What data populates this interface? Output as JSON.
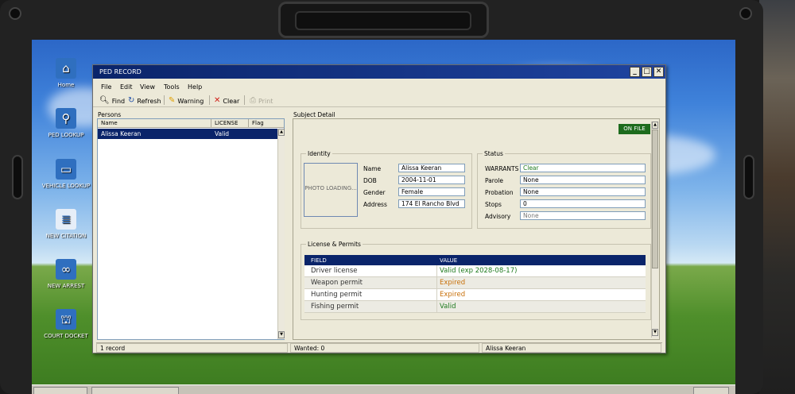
{
  "window": {
    "title": "PED RECORD",
    "min": "_",
    "max": "□",
    "close": "✕"
  },
  "desktop": {
    "icons": [
      {
        "label": "Home",
        "icon": "home-icon"
      },
      {
        "label": "PED LOOKUP",
        "icon": "person-search-icon"
      },
      {
        "label": "VEHICLE LOOKUP",
        "icon": "vehicle-search-icon"
      },
      {
        "label": "NEW CITATION",
        "icon": "citation-icon"
      },
      {
        "label": "NEW ARREST",
        "icon": "handcuffs-icon"
      },
      {
        "label": "COURT DOCKET",
        "icon": "courthouse-icon"
      }
    ]
  },
  "menu": {
    "file": "File",
    "edit": "Edit",
    "view": "View",
    "tools": "Tools",
    "help": "Help"
  },
  "toolbar": {
    "find": "Find",
    "refresh": "Refresh",
    "warning": "Warning",
    "clear": "Clear",
    "print": "Print"
  },
  "persons": {
    "label": "Persons",
    "columns": {
      "name": "Name",
      "license": "LICENSE",
      "flag": "Flag"
    },
    "rows": [
      {
        "name": "Alissa Keeran",
        "license": "Valid",
        "flag": ""
      }
    ]
  },
  "detail": {
    "label": "Subject Detail",
    "badge": "ON FILE",
    "identity": {
      "label": "Identity",
      "photo_text": "PHOTO LOADING...",
      "fields": {
        "name_label": "Name",
        "name": "Alissa Keeran",
        "dob_label": "DOB",
        "dob": "2004-11-01",
        "gender_label": "Gender",
        "gender": "Female",
        "address_label": "Address",
        "address": "174 El Rancho Blvd"
      }
    },
    "status": {
      "label": "Status",
      "fields": {
        "warrants_label": "WARRANTS",
        "warrants": "Clear",
        "parole_label": "Parole",
        "parole": "None",
        "probation_label": "Probation",
        "probation": "None",
        "stops_label": "Stops",
        "stops": "0",
        "advisory_label": "Advisory",
        "advisory": "None"
      }
    },
    "licenses": {
      "label": "License & Permits",
      "columns": {
        "field": "FIELD",
        "value": "VALUE"
      },
      "rows": [
        {
          "field": "Driver license",
          "value": "Valid (exp 2028-08-17)",
          "color": "#1e7a1e"
        },
        {
          "field": "Weapon permit",
          "value": "Expired",
          "color": "#c8700a"
        },
        {
          "field": "Hunting permit",
          "value": "Expired",
          "color": "#c8700a"
        },
        {
          "field": "Fishing permit",
          "value": "Valid",
          "color": "#1e7a1e"
        }
      ]
    }
  },
  "statusbar": {
    "records": "1 record",
    "wanted": "Wanted: 0",
    "subject": "Alissa Keeran"
  },
  "colors": {
    "titlebar": "#0a246a",
    "valid": "#1e7a1e",
    "expired": "#c8700a",
    "on_file": "#1d6b1d"
  }
}
